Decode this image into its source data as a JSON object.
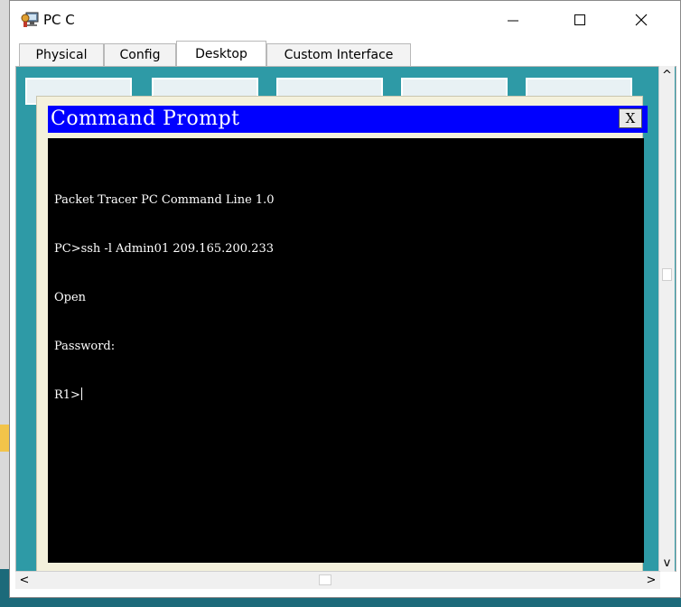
{
  "window": {
    "title": "PC C",
    "minimize_glyph": "—",
    "maximize_glyph": "☐",
    "close_glyph": "✕"
  },
  "tabs": [
    {
      "label": "Physical",
      "active": false
    },
    {
      "label": "Config",
      "active": false
    },
    {
      "label": "Desktop",
      "active": true
    },
    {
      "label": "Custom Interface",
      "active": false
    }
  ],
  "command_prompt": {
    "title": "Command Prompt",
    "close_label": "X",
    "lines": [
      "Packet Tracer PC Command Line 1.0",
      "PC>ssh -l Admin01 209.165.200.233",
      "Open",
      "Password:",
      "R1>"
    ]
  },
  "scrollbars": {
    "up_arrow": "^",
    "down_arrow": "v",
    "left_arrow": "<",
    "right_arrow": ">"
  },
  "colors": {
    "title_bar_blue": "#0000ff",
    "terminal_bg": "#000000",
    "terminal_fg": "#ffffff",
    "desktop_teal": "#2e9aa6",
    "prompt_frame": "#f4f1dc"
  },
  "icons": {
    "app_icon": "pc-icon",
    "minimize": "minimize-icon",
    "maximize": "maximize-icon",
    "close": "close-icon"
  }
}
